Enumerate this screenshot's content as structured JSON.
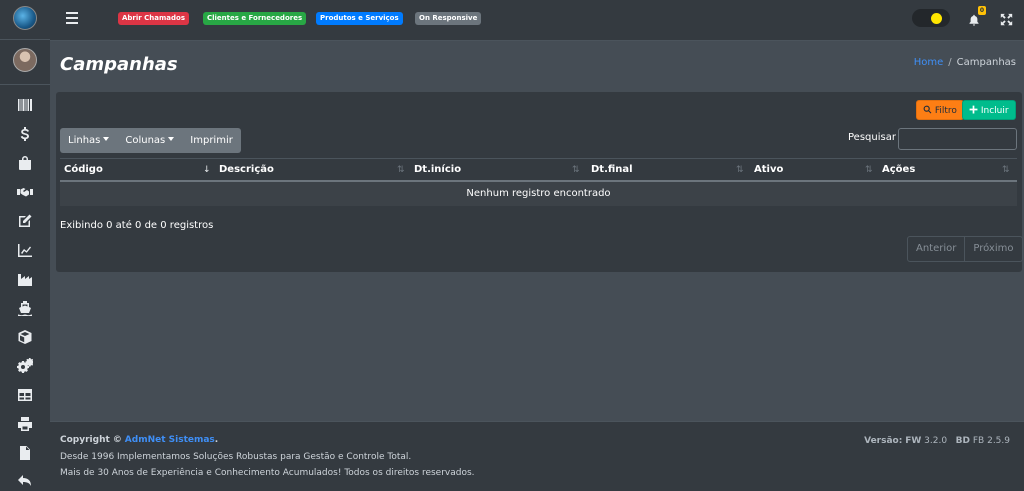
{
  "topbar": {
    "badges": [
      {
        "label": "Abrir Chamados",
        "color": "#dc3545"
      },
      {
        "label": "Clientes e Fornecedores",
        "color": "#28a745"
      },
      {
        "label": "Produtos e Serviços",
        "color": "#007bff"
      },
      {
        "label": "On Responsive",
        "color": "#6c757d"
      }
    ],
    "notification_count": "0"
  },
  "sidebar": {
    "icons": [
      "barcode-icon",
      "dollar-icon",
      "shopping-bag-icon",
      "handshake-icon",
      "edit-icon",
      "chart-line-icon",
      "industry-icon",
      "ship-icon",
      "cube-icon",
      "cogs-icon",
      "table-icon",
      "print-icon",
      "file-icon",
      "undo-icon"
    ]
  },
  "header": {
    "title": "Campanhas",
    "breadcrumb": {
      "home": "Home",
      "separator": "/",
      "current": "Campanhas"
    }
  },
  "toolbar": {
    "filtro_label": "Filtro",
    "incluir_label": "Incluir",
    "linhas_label": "Linhas",
    "colunas_label": "Colunas",
    "imprimir_label": "Imprimir",
    "search_label": "Pesquisar",
    "search_value": ""
  },
  "table": {
    "columns": [
      "Código",
      "Descrição",
      "Dt.início",
      "Dt.final",
      "Ativo",
      "Ações"
    ],
    "sorted_column": "Código",
    "empty_message": "Nenhum registro encontrado",
    "info": "Exibindo 0 até 0 de 0 registros",
    "prev_label": "Anterior",
    "next_label": "Próximo"
  },
  "footer": {
    "copyright_prefix": "Copyright ©",
    "brand": "AdmNet Sistemas",
    "copyright_suffix": ".",
    "line2": "Desde 1996 Implementamos Soluções Robustas para Gestão e Controle Total.",
    "line3": "Mais de 30 Anos de Experiência e Conhecimento Acumulados! Todos os direitos reservados.",
    "version_label": "Versão:",
    "fw_label": "FW",
    "fw_value": "3.2.0",
    "bd_label": "BD",
    "bd_value": "FB 2.5.9"
  },
  "colors": {
    "sidebar_bg": "#343a40",
    "content_bg": "#454d55",
    "accent_blue": "#3f8ff6",
    "filtro": "#fd7e14",
    "incluir": "#00bc8c"
  }
}
